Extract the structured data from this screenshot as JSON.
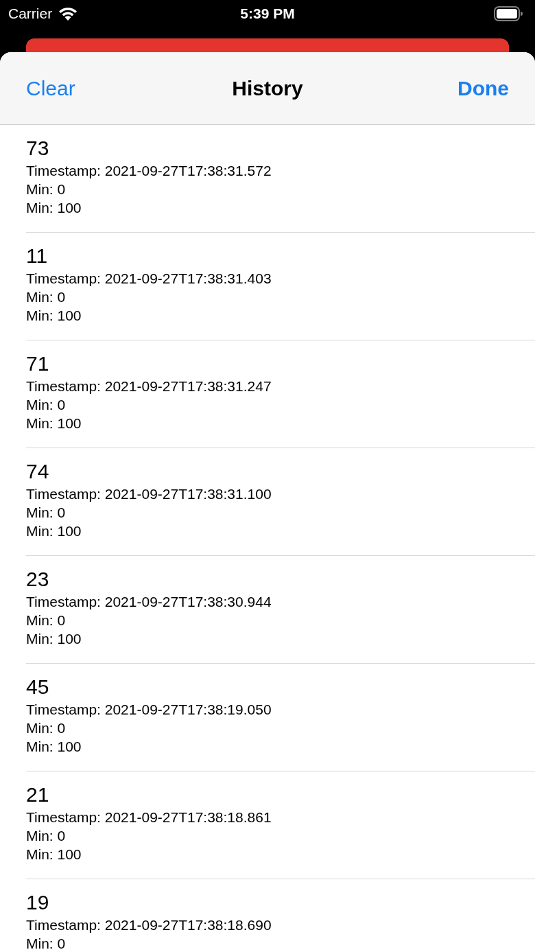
{
  "status_bar": {
    "carrier": "Carrier",
    "time": "5:39 PM"
  },
  "nav": {
    "left": "Clear",
    "title": "History",
    "right": "Done"
  },
  "rows": [
    {
      "value": "73",
      "lines": [
        "Timestamp: 2021-09-27T17:38:31.572",
        "Min: 0",
        "Min: 100"
      ]
    },
    {
      "value": "11",
      "lines": [
        "Timestamp: 2021-09-27T17:38:31.403",
        "Min: 0",
        "Min: 100"
      ]
    },
    {
      "value": "71",
      "lines": [
        "Timestamp: 2021-09-27T17:38:31.247",
        "Min: 0",
        "Min: 100"
      ]
    },
    {
      "value": "74",
      "lines": [
        "Timestamp: 2021-09-27T17:38:31.100",
        "Min: 0",
        "Min: 100"
      ]
    },
    {
      "value": "23",
      "lines": [
        "Timestamp: 2021-09-27T17:38:30.944",
        "Min: 0",
        "Min: 100"
      ]
    },
    {
      "value": "45",
      "lines": [
        "Timestamp: 2021-09-27T17:38:19.050",
        "Min: 0",
        "Min: 100"
      ]
    },
    {
      "value": "21",
      "lines": [
        "Timestamp: 2021-09-27T17:38:18.861",
        "Min: 0",
        "Min: 100"
      ]
    },
    {
      "value": "19",
      "lines": [
        "Timestamp: 2021-09-27T17:38:18.690",
        "Min: 0"
      ]
    }
  ]
}
